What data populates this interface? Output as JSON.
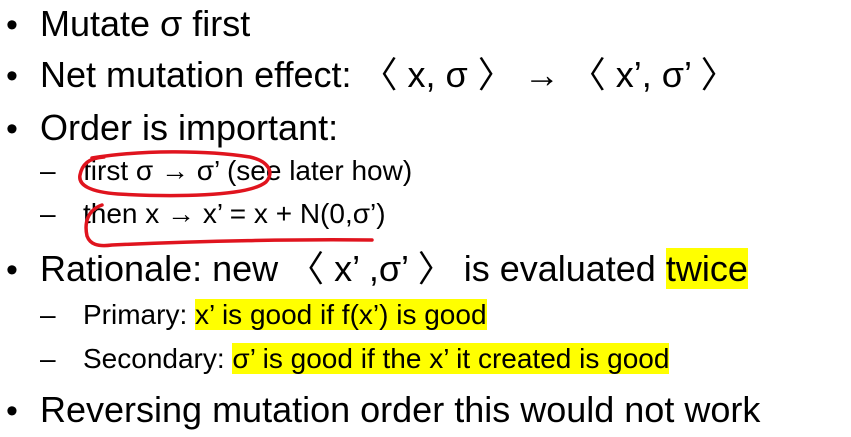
{
  "slide": {
    "lines": [
      {
        "level": 1,
        "marker": "•",
        "text": "Mutate σ first"
      },
      {
        "level": 1,
        "marker": "•",
        "text": "Net mutation effect: 〈 x, σ 〉 → 〈 x’, σ’ 〉"
      },
      {
        "level": 1,
        "marker": "•",
        "text": "Order is important:"
      },
      {
        "level": 2,
        "marker": "–",
        "text": "first σ → σ’ (see later how)"
      },
      {
        "level": 2,
        "marker": "–",
        "text": "then x → x’ = x + N(0,σ’)"
      },
      {
        "level": 1,
        "marker": "•",
        "text_before_highlight": "Rationale: new 〈 x’ ,σ’ 〉 is evaluated ",
        "highlight": "twice"
      },
      {
        "level": 2,
        "marker": "–",
        "text_before_highlight": "Primary: ",
        "highlight": "x’ is good if f(x’) is good"
      },
      {
        "level": 2,
        "marker": "–",
        "text_before_highlight": "Secondary: ",
        "highlight": "σ’ is good if the x’ it created is good"
      },
      {
        "level": 1,
        "marker": "•",
        "text": "Reversing mutation order this would not work"
      }
    ]
  },
  "colors": {
    "text": "#000000",
    "highlight": "#ffff00",
    "annotation_ink": "#e0141e"
  }
}
